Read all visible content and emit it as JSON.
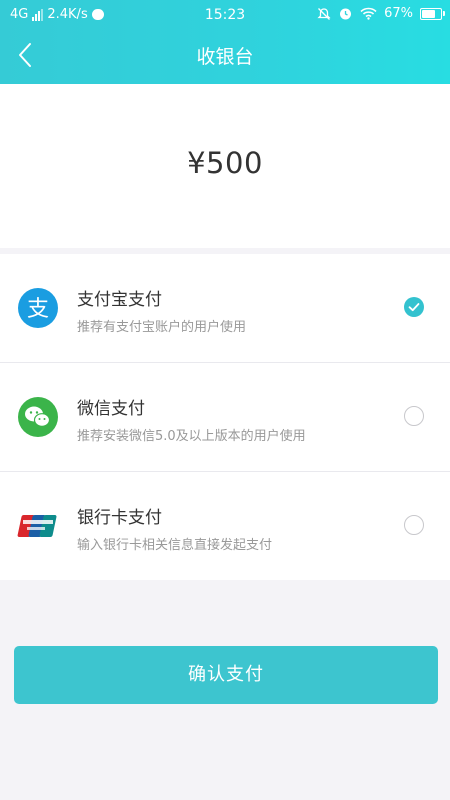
{
  "status_bar": {
    "network": "4G",
    "speed": "2.4K/s",
    "time": "15:23",
    "battery": "67%",
    "battery_level": 0.67
  },
  "header": {
    "title": "收银台"
  },
  "amount": "¥500",
  "payment_methods": [
    {
      "name": "支付宝支付",
      "desc": "推荐有支付宝账户的用户使用",
      "selected": true
    },
    {
      "name": "微信支付",
      "desc": "推荐安装微信5.0及以上版本的用户使用",
      "selected": false
    },
    {
      "name": "银行卡支付",
      "desc": "输入银行卡相关信息直接发起支付",
      "selected": false
    }
  ],
  "confirm_label": "确认支付",
  "colors": {
    "accent": "#33c2cf",
    "alipay": "#1a9de1",
    "wechat": "#3bb44a",
    "unionpay_red": "#d9262c",
    "unionpay_blue": "#1b5ea6"
  }
}
